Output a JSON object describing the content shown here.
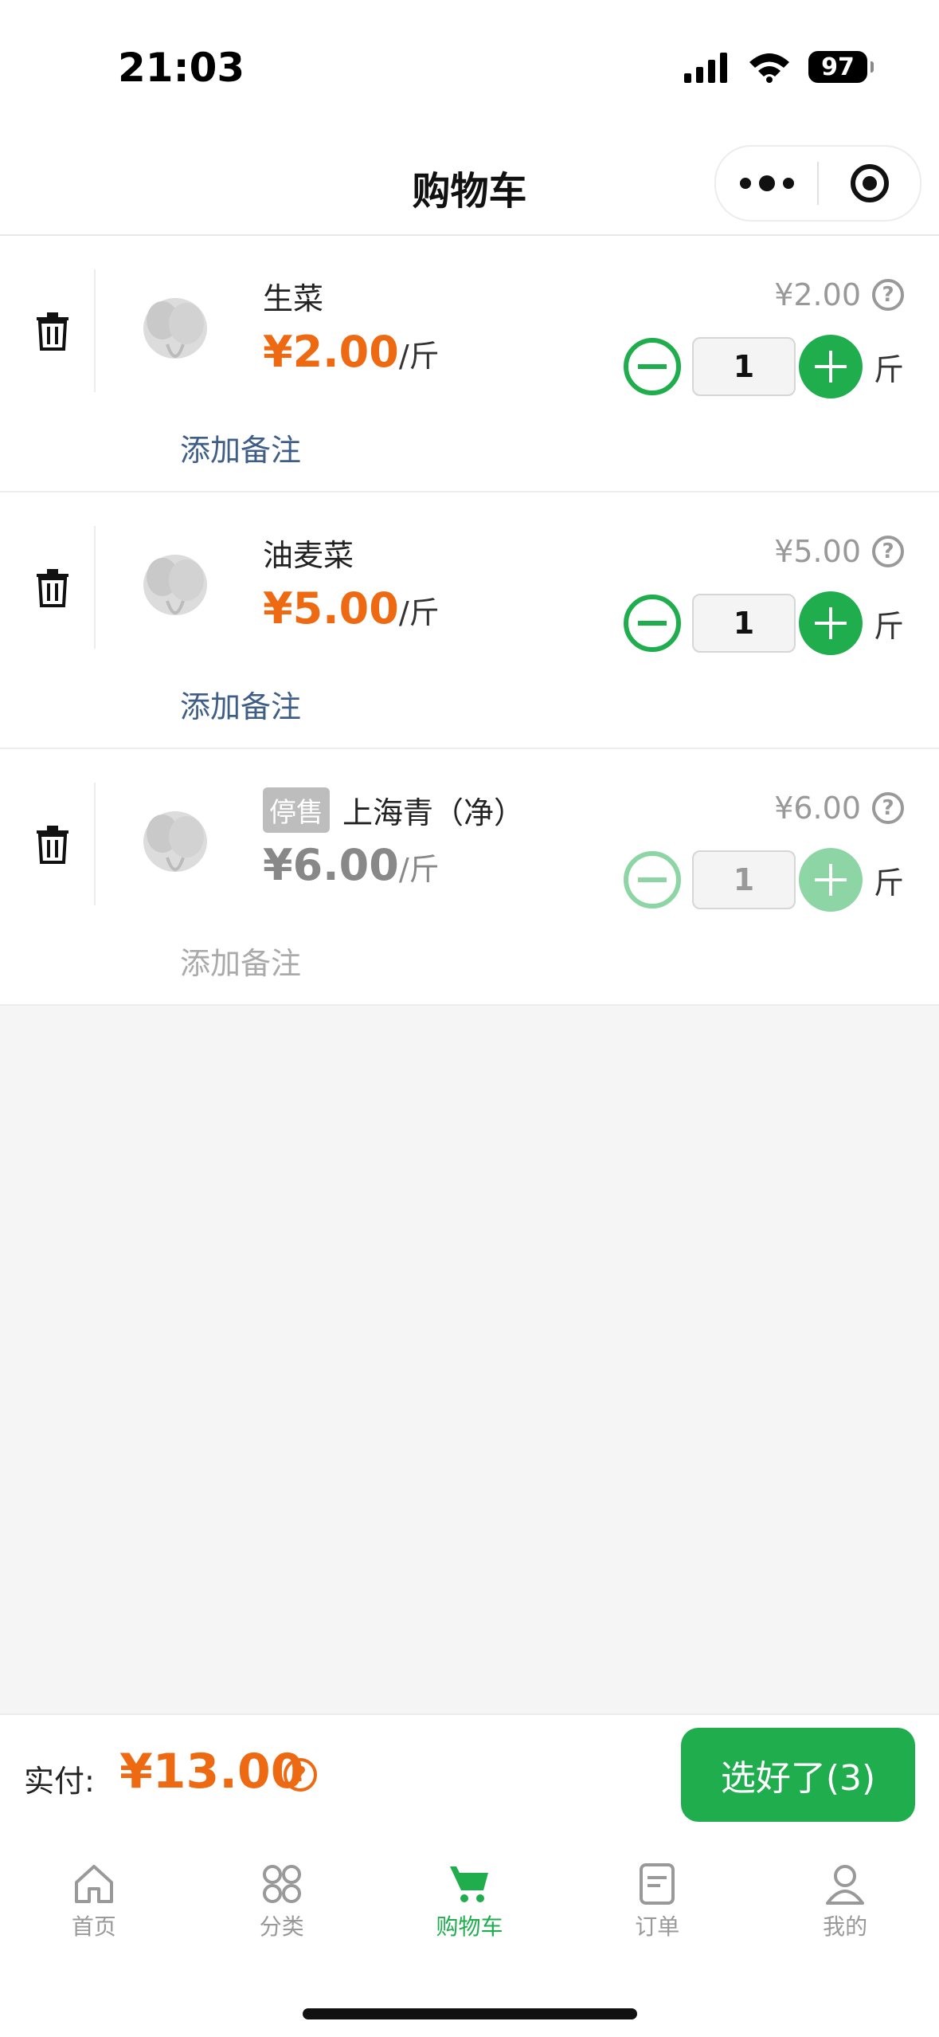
{
  "status": {
    "time": "21:03",
    "battery": "97"
  },
  "navbar": {
    "title": "购物车"
  },
  "cart_items": [
    {
      "name": "生菜",
      "tag": "",
      "price": "¥2.00",
      "unit": "/斤",
      "subtotal": "¥2.00",
      "quantity": "1",
      "qty_unit": "斤",
      "note_label": "添加备注"
    },
    {
      "name": "油麦菜",
      "tag": "",
      "price": "¥5.00",
      "unit": "/斤",
      "subtotal": "¥5.00",
      "quantity": "1",
      "qty_unit": "斤",
      "note_label": "添加备注"
    },
    {
      "name": "上海青（净）",
      "tag": "停售",
      "price": "¥6.00",
      "unit": "/斤",
      "subtotal": "¥6.00",
      "quantity": "1",
      "qty_unit": "斤",
      "note_label": "添加备注"
    }
  ],
  "summary": {
    "pay_label": "实付:",
    "total": "¥13.00",
    "checkout_label": "选好了(3)"
  },
  "tabs": [
    {
      "label": "首页",
      "icon": "home-icon"
    },
    {
      "label": "分类",
      "icon": "category-icon"
    },
    {
      "label": "购物车",
      "icon": "cart-icon"
    },
    {
      "label": "订单",
      "icon": "order-icon"
    },
    {
      "label": "我的",
      "icon": "profile-icon"
    }
  ],
  "colors": {
    "accent": "#1fad4e",
    "price": "#ee6a12",
    "note": "#3e5e88"
  }
}
